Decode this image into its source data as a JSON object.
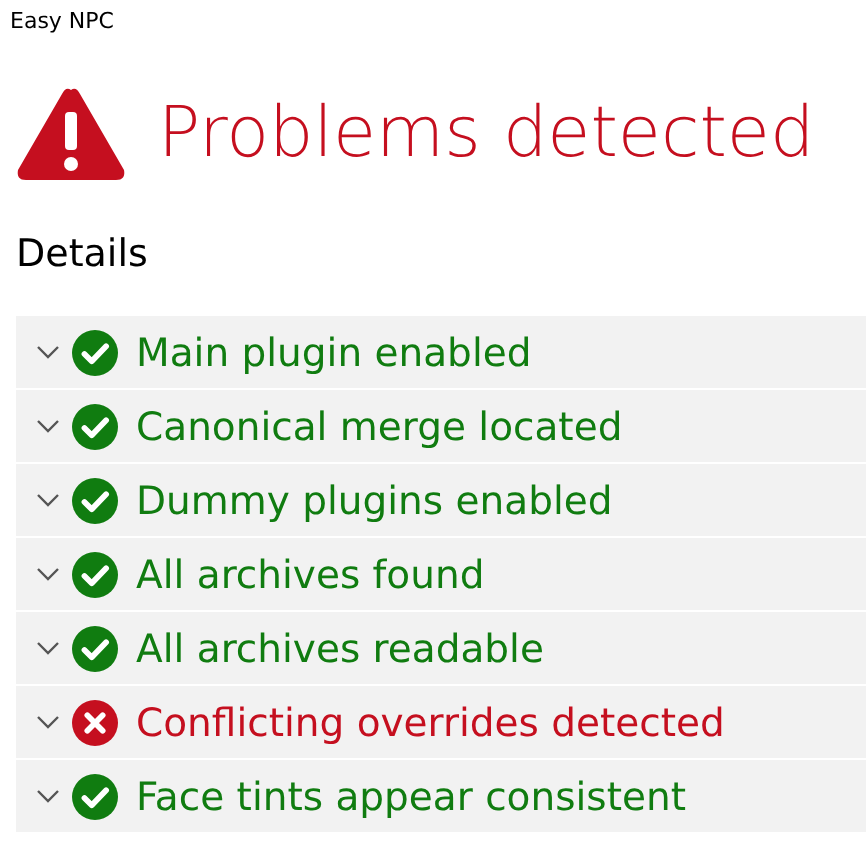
{
  "window": {
    "title": "Easy NPC"
  },
  "heading": {
    "kind": "error",
    "text": "Problems detected"
  },
  "section": {
    "title": "Details"
  },
  "checks": [
    {
      "kind": "pass",
      "label": "Main plugin enabled"
    },
    {
      "kind": "pass",
      "label": "Canonical merge located"
    },
    {
      "kind": "pass",
      "label": "Dummy plugins enabled"
    },
    {
      "kind": "pass",
      "label": "All archives found"
    },
    {
      "kind": "pass",
      "label": "All archives readable"
    },
    {
      "kind": "fail",
      "label": "Conflicting overrides detected"
    },
    {
      "kind": "pass",
      "label": "Face tints appear consistent"
    }
  ]
}
